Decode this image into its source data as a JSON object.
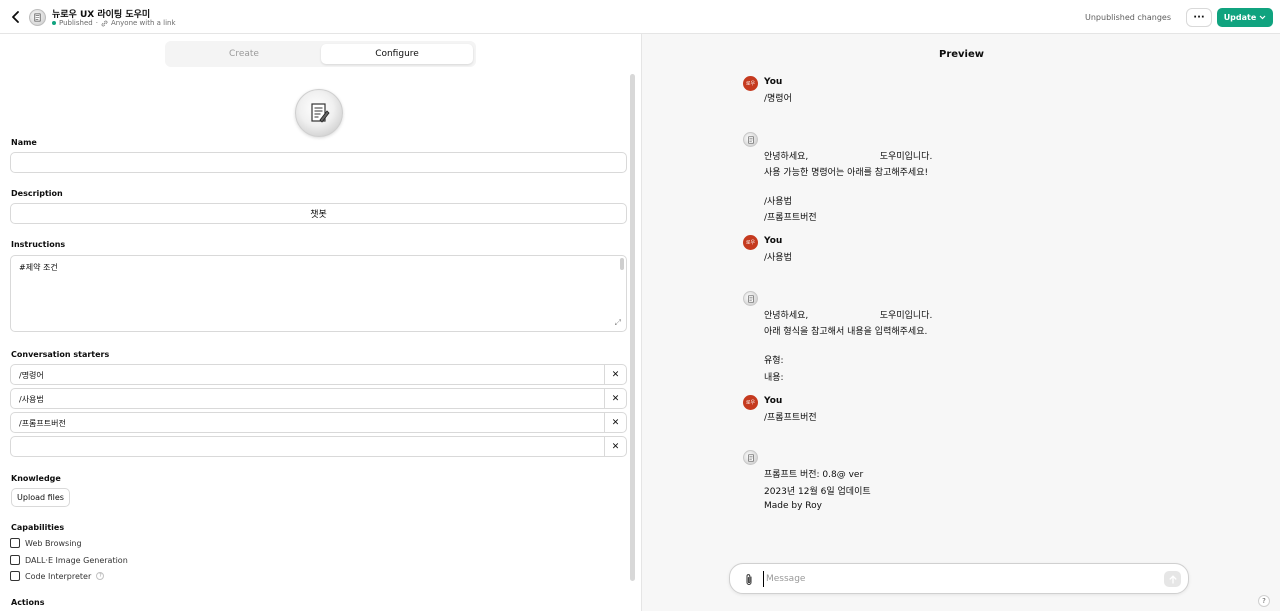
{
  "header": {
    "gpt_name": "뉴로우 UX 라이팅 도우미",
    "status": "Published",
    "visibility": "Anyone with a link",
    "unpublished_label": "Unpublished changes",
    "more_label": "···",
    "update_label": "Update"
  },
  "tabs": [
    {
      "label": "Create"
    },
    {
      "label": "Configure"
    }
  ],
  "form": {
    "name_label": "Name",
    "name_value": "",
    "description_label": "Description",
    "description_value": "챗봇",
    "instructions_label": "Instructions",
    "instructions_value": "#제약 조건",
    "starters_label": "Conversation starters",
    "starters": [
      "/명령어",
      "/사용법",
      "/프롬프트버전",
      ""
    ],
    "remove_glyph": "✕",
    "knowledge_label": "Knowledge",
    "upload_label": "Upload files",
    "capabilities_label": "Capabilities",
    "capabilities": [
      {
        "label": "Web Browsing",
        "checked": false
      },
      {
        "label": "DALL·E Image Generation",
        "checked": false
      },
      {
        "label": "Code Interpreter",
        "checked": false
      }
    ],
    "help_glyph": "?",
    "actions_label": "Actions"
  },
  "preview": {
    "title": "Preview",
    "user_initials": "로우",
    "messages": [
      {
        "role": "user",
        "name": "You",
        "lines": [
          "/명령어"
        ]
      },
      {
        "role": "bot",
        "lines": [
          "안녕하세요,                         도우미입니다.",
          "사용 가능한 명령어는 아래를 참고해주세요!",
          "",
          "/사용법",
          "/프롬프트버전"
        ]
      },
      {
        "role": "user",
        "name": "You",
        "lines": [
          "/사용법"
        ]
      },
      {
        "role": "bot",
        "lines": [
          "안녕하세요,                         도우미입니다.",
          "아래 형식을 참고해서 내용을 입력해주세요.",
          "",
          "유형:",
          "내용:"
        ]
      },
      {
        "role": "user",
        "name": "You",
        "lines": [
          "/프롬프트버전"
        ]
      },
      {
        "role": "bot",
        "lines": [
          "프롬프트 버전: 0.8@ ver",
          "2023년 12월 6일 업데이트",
          "Made by Roy"
        ]
      }
    ],
    "composer_placeholder": "Message",
    "help_label": "?"
  },
  "colors": {
    "accent": "#10a37f",
    "user_avatar": "#c53a1f"
  }
}
